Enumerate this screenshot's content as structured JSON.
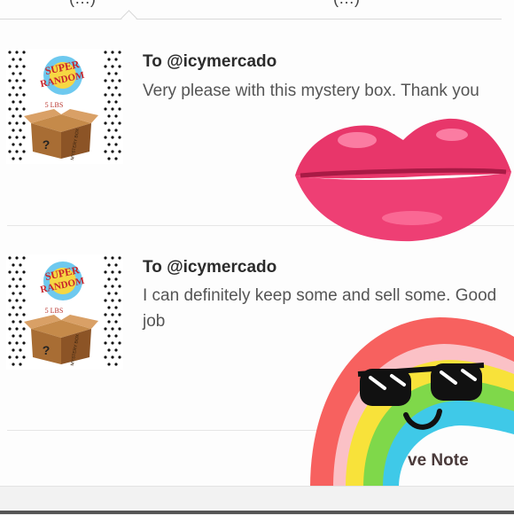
{
  "tabs": [
    {
      "label": "(…)"
    },
    {
      "label": "(…)"
    }
  ],
  "reviews": [
    {
      "recipient": "To @icymercado",
      "text": "Very please with this mystery box. Thank you",
      "thumbnail": {
        "title_1": "SUPER",
        "title_2": "RANDOM",
        "weight": "5 LBS",
        "box_mark": "?",
        "box_label": "MYSTERY BOX"
      }
    },
    {
      "recipient": "To @icymercado",
      "text": "I can definitely keep some and sell some. Good job",
      "thumbnail": {
        "title_1": "SUPER",
        "title_2": "RANDOM",
        "weight": "5 LBS",
        "box_mark": "?",
        "box_label": "MYSTERY BOX"
      }
    }
  ],
  "stickers": {
    "lips": {
      "icon": "lips-sticker"
    },
    "rainbow": {
      "icon": "rainbow-sunglasses-sticker",
      "caption": "ve Note"
    }
  },
  "colors": {
    "lips": "#e8366a",
    "lip_shine": "#ff8fb0",
    "rainbow_red": "#f7615f",
    "rainbow_yellow": "#f8e23a",
    "rainbow_green": "#7fd84a",
    "rainbow_blue": "#3fc9e8",
    "rainbow_purple": "#6fd9f0"
  }
}
